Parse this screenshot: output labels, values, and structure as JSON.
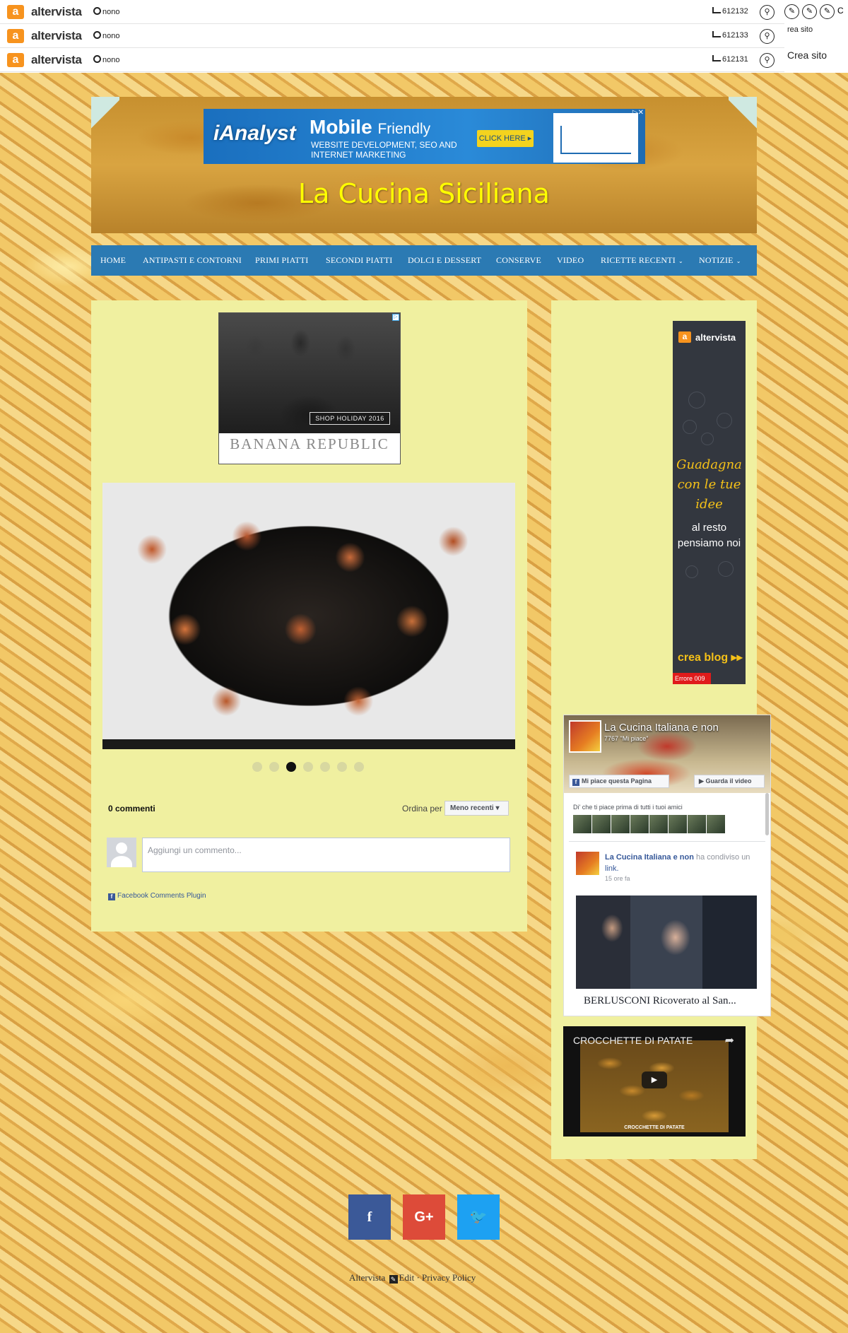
{
  "altervista_bars": [
    {
      "logo_letter": "a",
      "logo_text": "altervista",
      "user": "nono",
      "count": "612132"
    },
    {
      "logo_letter": "a",
      "logo_text": "altervista",
      "user": "nono",
      "count": "612133"
    },
    {
      "logo_letter": "a",
      "logo_text": "altervista",
      "user": "nono",
      "count": "612131"
    }
  ],
  "side_panel": {
    "small_text": "rea sito",
    "big_text": "Crea sito",
    "partial": "C"
  },
  "header_ad": {
    "brand": "iAnalyst",
    "headline": "Mobile",
    "headline_suffix": "Friendly",
    "line1": "WEBSITE DEVELOPMENT, SEO AND",
    "line2": "INTERNET MARKETING",
    "cta": "CLICK HERE ▸",
    "close": "▷✕"
  },
  "site_title": "La Cucina Siciliana",
  "nav": [
    {
      "label": "HOME",
      "dropdown": false
    },
    {
      "label": "ANTIPASTI E CONTORNI",
      "dropdown": false
    },
    {
      "label": "PRIMI PIATTI",
      "dropdown": false
    },
    {
      "label": "SECONDI PIATTI",
      "dropdown": false
    },
    {
      "label": "DOLCI E DESSERT",
      "dropdown": false
    },
    {
      "label": "CONSERVE",
      "dropdown": false
    },
    {
      "label": "VIDEO",
      "dropdown": false
    },
    {
      "label": "RICETTE RECENTI",
      "dropdown": true
    },
    {
      "label": "NOTIZIE",
      "dropdown": true
    }
  ],
  "content_ad": {
    "tag": "SHOP HOLIDAY 2016",
    "brand": "BANANA REPUBLIC",
    "choice": "▷"
  },
  "slider": {
    "slide_count": 7,
    "active_index": 2
  },
  "comments": {
    "count_label": "0 commenti",
    "sort_label": "Ordina per",
    "sort_value": "Meno recenti ▾",
    "input_placeholder": "Aggiungi un commento...",
    "plugin_label": "Facebook Comments Plugin",
    "plugin_icon": "f"
  },
  "sidebar_ad": {
    "logo_letter": "a",
    "logo_text": "altervista",
    "headline": "Guadagna con le tue idee",
    "subline": "al resto pensiamo noi",
    "cta": "crea blog ▸▸",
    "error": "Errore 009"
  },
  "fb_page": {
    "name": "La Cucina Italiana e non",
    "likes": "7767 \"Mi piace\"",
    "like_button": "Mi piace questa Pagina",
    "watch_button": "Guarda il video",
    "friends_text": "Di' che ti piace prima di tutti i tuoi amici",
    "post_author": "La Cucina Italiana e non",
    "post_action": "ha condiviso un",
    "post_link": "link.",
    "post_time": "15 ore fa",
    "post_title": "BERLUSCONI Ricoverato al San..."
  },
  "video": {
    "title": "CROCCHETTE DI PATATE",
    "caption": "CROCCHETTE DI PATATE"
  },
  "social": {
    "facebook": "f",
    "google": "G+",
    "twitter": "🐦"
  },
  "footer": {
    "link1": "Altervista",
    "edit": "Edit",
    "separator": "·",
    "link2": "Privacy Policy"
  },
  "colors": {
    "nav": "#2b7ab3",
    "panel": "#f0f0a0",
    "title": "#ffff00",
    "facebook": "#3b5998",
    "google": "#dd4b39",
    "twitter": "#1da1f2"
  }
}
